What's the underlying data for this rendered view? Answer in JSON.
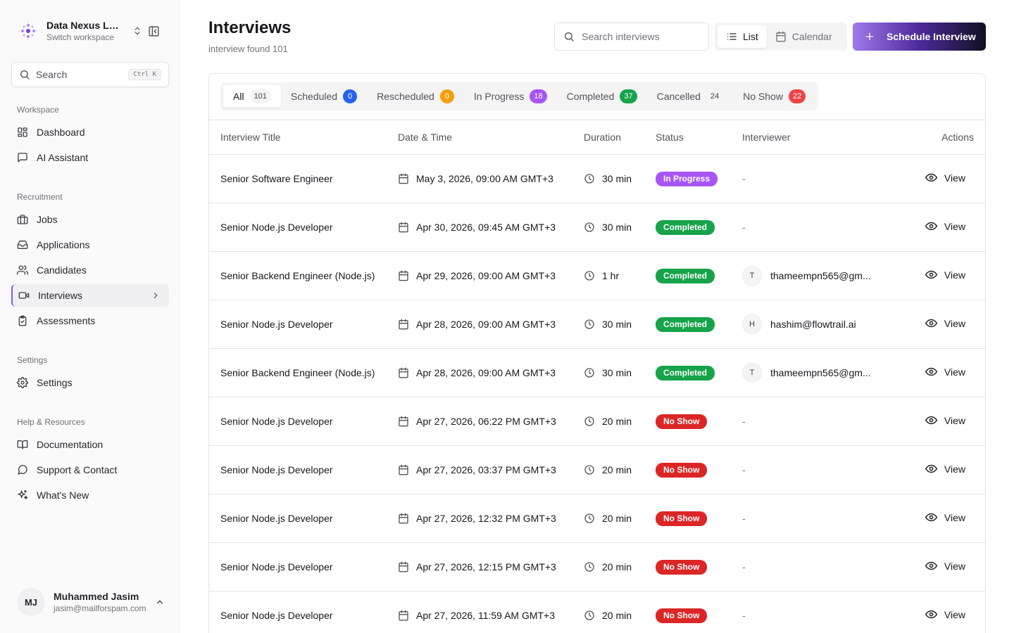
{
  "sidebar": {
    "workspace": {
      "name": "Data Nexus Labs",
      "subtitle": "Switch workspace"
    },
    "search": {
      "label": "Search",
      "shortcut": "Ctrl K"
    },
    "sections": [
      {
        "title": "Workspace",
        "items": [
          {
            "label": "Dashboard",
            "icon": "dashboard-icon"
          },
          {
            "label": "AI Assistant",
            "icon": "chat-icon"
          }
        ]
      },
      {
        "title": "Recruitment",
        "items": [
          {
            "label": "Jobs",
            "icon": "briefcase-icon"
          },
          {
            "label": "Applications",
            "icon": "inbox-icon"
          },
          {
            "label": "Candidates",
            "icon": "users-icon"
          },
          {
            "label": "Interviews",
            "icon": "video-icon",
            "active": true
          },
          {
            "label": "Assessments",
            "icon": "clipboard-icon"
          }
        ]
      },
      {
        "title": "Settings",
        "items": [
          {
            "label": "Settings",
            "icon": "gear-icon"
          }
        ]
      },
      {
        "title": "Help & Resources",
        "items": [
          {
            "label": "Documentation",
            "icon": "book-icon"
          },
          {
            "label": "Support & Contact",
            "icon": "message-circle-icon"
          },
          {
            "label": "What's New",
            "icon": "sparkles-icon"
          }
        ]
      }
    ],
    "user": {
      "initials": "MJ",
      "name": "Muhammed Jasim",
      "email": "jasim@mailforspam.com"
    }
  },
  "header": {
    "title": "Interviews",
    "subtitle": "interview found 101",
    "search_placeholder": "Search interviews",
    "view_toggle": {
      "list": "List",
      "calendar": "Calendar",
      "active": "list"
    },
    "schedule_button": "Schedule Interview"
  },
  "tabs": [
    {
      "label": "All",
      "count": "101",
      "color": "",
      "active": true
    },
    {
      "label": "Scheduled",
      "count": "0",
      "color": "#2563eb"
    },
    {
      "label": "Rescheduled",
      "count": "0",
      "color": "#f59e0b"
    },
    {
      "label": "In Progress",
      "count": "18",
      "color": "#a855f7"
    },
    {
      "label": "Completed",
      "count": "37",
      "color": "#16a34a"
    },
    {
      "label": "Cancelled",
      "count": "24",
      "color": ""
    },
    {
      "label": "No Show",
      "count": "22",
      "color": "#ef4444"
    }
  ],
  "table": {
    "columns": [
      "Interview Title",
      "Date & Time",
      "Duration",
      "Status",
      "Interviewer",
      "Actions"
    ],
    "action_label": "View",
    "empty_interviewer": "-",
    "status_colors": {
      "In Progress": "#a855f7",
      "Completed": "#16a34a",
      "No Show": "#dc2626"
    },
    "rows": [
      {
        "title": "Senior Software Engineer",
        "datetime": "May 3, 2026, 09:00 AM GMT+3",
        "duration": "30 min",
        "status": "In Progress",
        "interviewer_initial": "",
        "interviewer": ""
      },
      {
        "title": "Senior Node.js Developer",
        "datetime": "Apr 30, 2026, 09:45 AM GMT+3",
        "duration": "30 min",
        "status": "Completed",
        "interviewer_initial": "",
        "interviewer": ""
      },
      {
        "title": "Senior Backend Engineer (Node.js)",
        "datetime": "Apr 29, 2026, 09:00 AM GMT+3",
        "duration": "1 hr",
        "status": "Completed",
        "interviewer_initial": "T",
        "interviewer": "thameempn565@gm..."
      },
      {
        "title": "Senior Node.js Developer",
        "datetime": "Apr 28, 2026, 09:00 AM GMT+3",
        "duration": "30 min",
        "status": "Completed",
        "interviewer_initial": "H",
        "interviewer": "hashim@flowtrail.ai"
      },
      {
        "title": "Senior Backend Engineer (Node.js)",
        "datetime": "Apr 28, 2026, 09:00 AM GMT+3",
        "duration": "30 min",
        "status": "Completed",
        "interviewer_initial": "T",
        "interviewer": "thameempn565@gm..."
      },
      {
        "title": "Senior Node.js Developer",
        "datetime": "Apr 27, 2026, 06:22 PM GMT+3",
        "duration": "20 min",
        "status": "No Show",
        "interviewer_initial": "",
        "interviewer": ""
      },
      {
        "title": "Senior Node.js Developer",
        "datetime": "Apr 27, 2026, 03:37 PM GMT+3",
        "duration": "20 min",
        "status": "No Show",
        "interviewer_initial": "",
        "interviewer": ""
      },
      {
        "title": "Senior Node.js Developer",
        "datetime": "Apr 27, 2026, 12:32 PM GMT+3",
        "duration": "20 min",
        "status": "No Show",
        "interviewer_initial": "",
        "interviewer": ""
      },
      {
        "title": "Senior Node.js Developer",
        "datetime": "Apr 27, 2026, 12:15 PM GMT+3",
        "duration": "20 min",
        "status": "No Show",
        "interviewer_initial": "",
        "interviewer": ""
      },
      {
        "title": "Senior Node.js Developer",
        "datetime": "Apr 27, 2026, 11:59 AM GMT+3",
        "duration": "20 min",
        "status": "No Show",
        "interviewer_initial": "",
        "interviewer": ""
      }
    ]
  }
}
